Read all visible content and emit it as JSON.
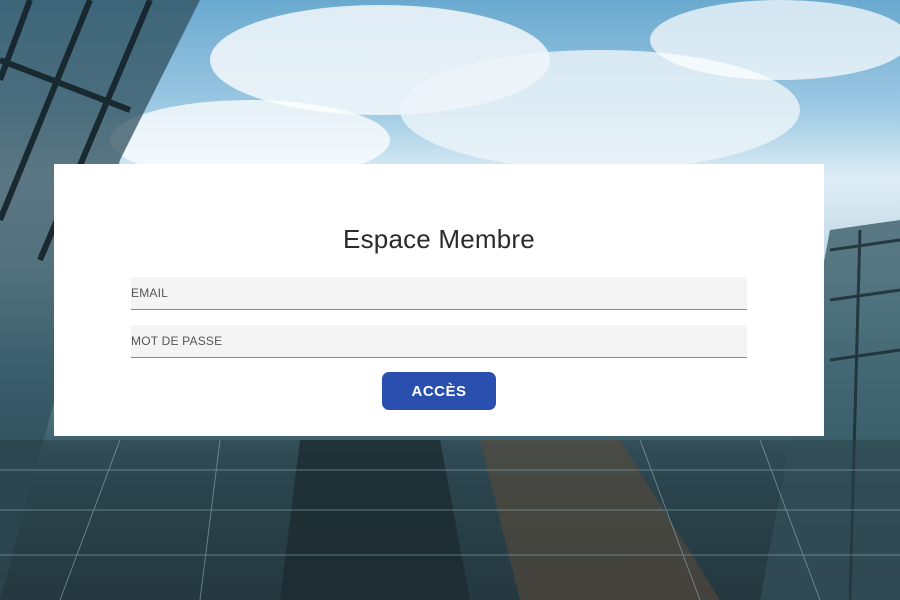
{
  "login": {
    "title": "Espace Membre",
    "email_placeholder": "EMAIL",
    "password_placeholder": "MOT DE PASSE",
    "submit_label": "ACCÈS"
  },
  "colors": {
    "button": "#2a4fae",
    "field_background": "#f4f4f4",
    "field_underline": "#6f8fc6",
    "card": "#ffffff"
  }
}
